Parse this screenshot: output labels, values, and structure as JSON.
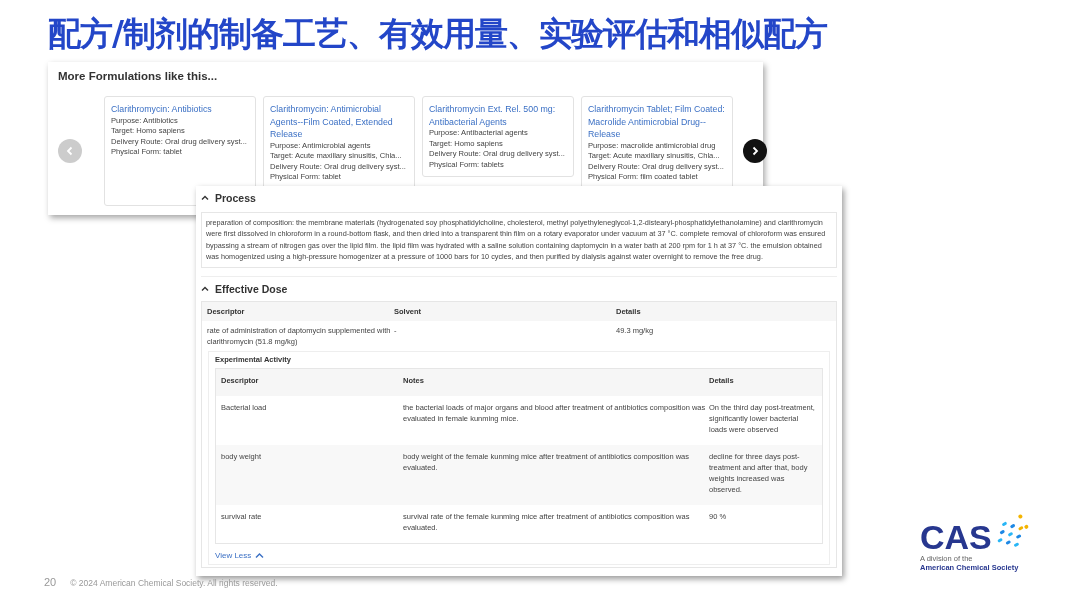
{
  "title": "配方/制剂的制备工艺、有效用量、实验评估和相似配方",
  "similar_panel": {
    "heading": "More Formulations like this...",
    "prev_button": {
      "disabled": true
    },
    "next_button": {
      "disabled": false
    },
    "cards": [
      {
        "title": "Clarithromycin: Antibiotics",
        "lines": [
          "Purpose: Antibiotics",
          "Target: Homo sapiens",
          "Delivery Route: Oral drug delivery syst...",
          "Physical Form: tablet"
        ]
      },
      {
        "title": "Clarithromycin: Antimicrobial Agents--Film Coated, Extended Release",
        "lines": [
          "Purpose: Antimicrobial agents",
          "Target: Acute maxillary sinusitis, Chla...",
          "Delivery Route: Oral drug delivery syst...",
          "Physical Form: tablet"
        ]
      },
      {
        "title": "Clarithromycin Ext. Rel. 500 mg: Antibacterial Agents",
        "lines": [
          "Purpose: Antibacterial agents",
          "Target: Homo sapiens",
          "Delivery Route: Oral drug delivery syst...",
          "Physical Form: tablets"
        ]
      },
      {
        "title": "Clarithromycin Tablet; Film Coated: Macrolide Antimicrobial Drug--Release",
        "lines": [
          "Purpose: macrolide antimicrobial drug",
          "Target: Acute maxillary sinusitis, Chla...",
          "Delivery Route: Oral drug delivery syst...",
          "Physical Form: film coated tablet"
        ]
      }
    ]
  },
  "process": {
    "heading": "Process",
    "expanded": true,
    "text": "preparation of composition: the membrane materials (hydrogenated soy phosphatidylcholine, cholesterol, methyl polyethyleneglycol-1,2-distearyl-phosphatidylethanolamine) and clarithromycin were first dissolved in chloroform in a round-bottom flask, and then dried into a transparent thin film on a rotary evaporator under vacuum at 37 °C. complete removal of chloroform was ensured bypassing a stream of nitrogen gas over the lipid film. the lipid film was hydrated with a saline solution containing daptomycin in a water bath at 200 rpm for 1 h at 37 °C. the emulsion obtained was homogenized using a high-pressure homogenizer at a pressure of 1000 bars for 10 cycles, and then purified by dialysis against water overnight to remove the free drug."
  },
  "effective_dose": {
    "heading": "Effective Dose",
    "expanded": true,
    "columns": [
      "Descriptor",
      "Solvent",
      "Details"
    ],
    "rows": [
      [
        "rate of administration of daptomycin supplemented with clarithromycin (51.8 mg/kg)",
        "-",
        "49.3 mg/kg"
      ]
    ],
    "experimental_activity": {
      "heading": "Experimental Activity",
      "columns": [
        "Descriptor",
        "Notes",
        "Details"
      ],
      "rows": [
        [
          "Bacterial load",
          "the bacterial loads of major organs and blood after treatment of antibiotics composition was evaluated in female kunming mice.",
          "On the third day post-treatment, significantly lower bacterial loads were observed"
        ],
        [
          "body weight",
          "body weight of the female kunming mice after treatment of antibiotics composition was evaluated.",
          "decline for three days post-treatment and after that, body weights increased was observed."
        ],
        [
          "survival rate",
          "survival rate of the female kunming mice after treatment of antibiotics composition was evaluated.",
          "90 %"
        ]
      ]
    },
    "view_less": "View Less"
  },
  "footer": {
    "page_number": "20",
    "copyright": "© 2024 American Chemical Society. All rights reserved."
  },
  "logo": {
    "name": "CAS",
    "tagline": [
      "A division of the",
      "American Chemical Society"
    ]
  }
}
